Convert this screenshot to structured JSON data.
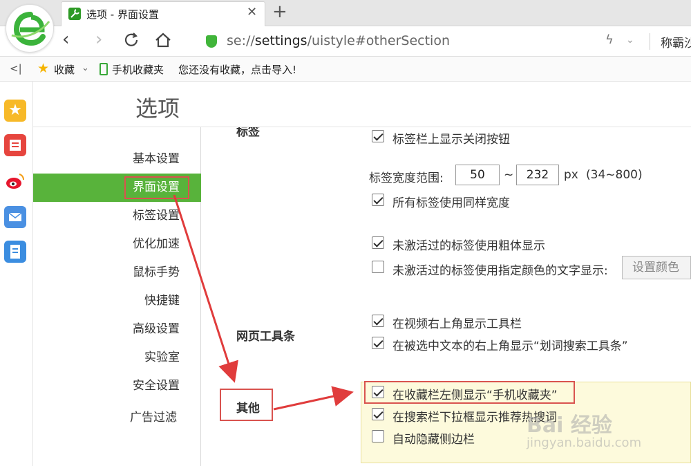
{
  "browser": {
    "tab_title": "选项 - 界面设置",
    "tab_close": "✕",
    "new_tab": "+",
    "url_prefix": "se://",
    "url_host": "settings",
    "url_path": "/uistyle#otherSection",
    "user_label": "称霸沙"
  },
  "bookmarks_bar": {
    "collapse_glyph": "<|",
    "favorites_label": "收藏",
    "mobile_folder_label": "手机收藏夹",
    "import_hint": "您还没有收藏，点击导入!"
  },
  "page": {
    "title": "选项",
    "nav_items": [
      {
        "label": "基本设置"
      },
      {
        "label": "界面设置",
        "active": true
      },
      {
        "label": "标签设置"
      },
      {
        "label": "优化加速"
      },
      {
        "label": "鼠标手势"
      },
      {
        "label": "快捷键"
      },
      {
        "label": "高级设置"
      },
      {
        "label": "实验室"
      },
      {
        "label": "安全设置"
      },
      {
        "label": "广告过滤"
      }
    ]
  },
  "tabs_section": {
    "label": "标签",
    "show_close_button": {
      "label": "标签栏上显示关闭按钮",
      "checked": true
    },
    "width_range": {
      "label": "标签宽度范围:",
      "min": "50",
      "sep": "~",
      "max": "232",
      "unit": "px",
      "hint": "(34~800)"
    },
    "same_width": {
      "label": "所有标签使用同样宽度",
      "checked": true
    },
    "bold_inactive": {
      "label": "未激活过的标签使用粗体显示",
      "checked": true
    },
    "color_inactive": {
      "label": "未激活过的标签使用指定颜色的文字显示:",
      "checked": false,
      "button": "设置颜色"
    }
  },
  "toolbar_section": {
    "label": "网页工具条",
    "video_toolbar": {
      "label": "在视频右上角显示工具栏",
      "checked": true
    },
    "selection_toolbar": {
      "label": "在被选中文本的右上角显示“划词搜索工具条”",
      "checked": true
    }
  },
  "other_section": {
    "label": "其他",
    "mobile_favorites": {
      "label": "在收藏栏左侧显示“手机收藏夹”",
      "checked": true
    },
    "search_suggest": {
      "label": "在搜索栏下拉框显示推荐热搜词",
      "checked": true
    },
    "auto_hide_sidebar": {
      "label": "自动隐藏侧边栏",
      "checked": false
    }
  },
  "watermark": {
    "text": "Bai 经验",
    "sub": "jingyan.baidu.com"
  },
  "colors": {
    "active_nav": "#58b33b",
    "highlight_bg": "#fdfadc",
    "annotation": "#d9534f",
    "brand": "#2e9a26"
  }
}
